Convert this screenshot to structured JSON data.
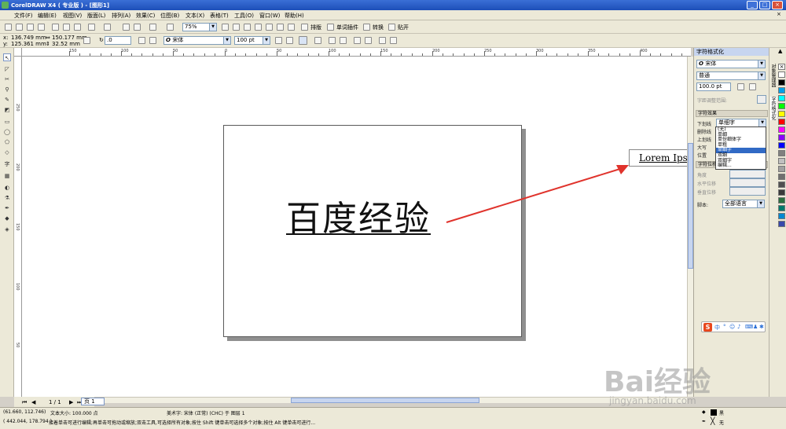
{
  "window": {
    "title": "CorelDRAW X4 ( 专业版 ) - [图形1]"
  },
  "menu": [
    "文件(F)",
    "编辑(E)",
    "视图(V)",
    "版面(L)",
    "排列(A)",
    "效果(C)",
    "位图(B)",
    "文本(X)",
    "表格(T)",
    "工具(O)",
    "窗口(W)",
    "帮助(H)"
  ],
  "toolbar": {
    "zoom": "75%",
    "buttons": [
      "排版",
      "单词插件",
      "转换",
      "贴开"
    ]
  },
  "propbar": {
    "x": "136.749 mm",
    "y": "125.361 mm",
    "w": "150.177 mm",
    "h": "32.52 mm",
    "angle": ".0",
    "font": "宋体",
    "size": "100 pt"
  },
  "ruler": {
    "h_labels": [
      "150",
      "100",
      "50",
      "0",
      "50",
      "100",
      "150",
      "200",
      "250",
      "300",
      "350",
      "400"
    ],
    "v_labels": [
      "250",
      "200",
      "150",
      "100",
      "50"
    ]
  },
  "canvas": {
    "main_text": "百度经验",
    "preview_text": "Lorem Ipsum"
  },
  "docker": {
    "title": "字符格式化",
    "font": "宋体",
    "style": "普通",
    "size": "100.0 pt",
    "kerning_label": "字距调整范围:",
    "section_effects": "字符效果",
    "underline_label": "下划线",
    "underline_value": "单细字",
    "rows": [
      "删除线",
      "上划线",
      "大写",
      "位置"
    ],
    "dropdown_options": [
      "(无)",
      "单细",
      "单份细体字",
      "单粗",
      "单细字",
      "双细",
      "双细字",
      "编辑..."
    ],
    "dropdown_selected_index": 4,
    "section_shift": "字符位移",
    "shift_rows": [
      "角度",
      "水平位移",
      "垂直位移"
    ],
    "script_label": "脚本:",
    "script_value": "全部语言"
  },
  "sidetabs": [
    "对象管理器",
    "字符格式化"
  ],
  "palette": [
    "#ffffff",
    "#000000",
    "#00a0e9",
    "#00ffff",
    "#00ff00",
    "#ffff00",
    "#ff0000",
    "#ff00ff",
    "#8b00ff",
    "#0000ff",
    "#808080",
    "#c0c0c0",
    "#a0a0a0",
    "#6f6f6f",
    "#505050",
    "#3a3a3a",
    "#2b6f3f",
    "#00796b",
    "#0288d1",
    "#3949ab"
  ],
  "pagenav": {
    "counter": "1 / 1",
    "tab": "页 1"
  },
  "status": {
    "coords": "(61.660, 112.746)",
    "objsize": "文本大小: 100.000 点",
    "objinfo": "美术字: 宋体 (正常) (CHC) 于 图层 1",
    "coords2": "( 442.044, 178.794 )",
    "hint": "接着单击可进行编辑;再单击可拖动或缩放;双击工具,可选择所有对象;按住 Shift 键单击可选择多个对象;按住 Alt 键单击可进行...",
    "fill_label": "黑",
    "outline_label": "无"
  },
  "watermark": {
    "brand": "Bai经验",
    "url": "jingyan.baidu.com"
  }
}
